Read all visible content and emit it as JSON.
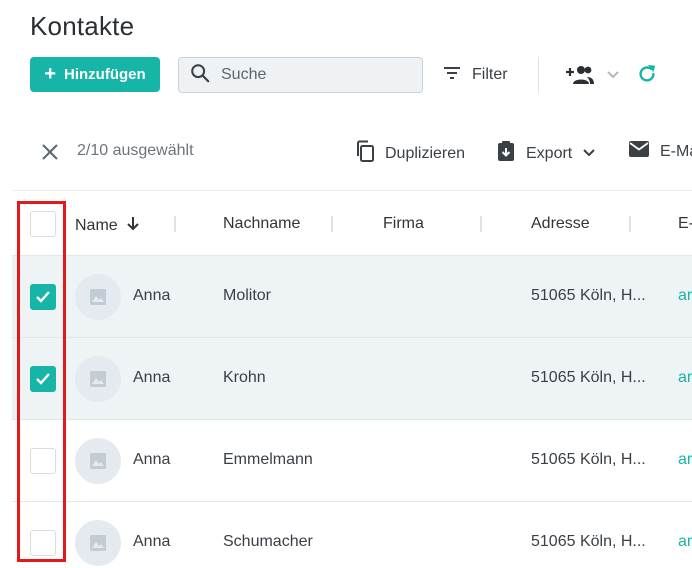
{
  "page": {
    "title": "Kontakte"
  },
  "toolbar": {
    "add_label": "Hinzufügen",
    "search_placeholder": "Suche",
    "filter_label": "Filter"
  },
  "selection_bar": {
    "count_text": "2/10 ausgewählt",
    "duplicate_label": "Duplizieren",
    "export_label": "Export",
    "email_label": "E-Ma"
  },
  "table": {
    "columns": {
      "name": "Name",
      "lastname": "Nachname",
      "company": "Firma",
      "address": "Adresse",
      "email": "E-"
    },
    "rows": [
      {
        "firstname": "Anna",
        "lastname": "Molitor",
        "company": "",
        "address": "51065 Köln, H...",
        "email": "ar",
        "selected": true
      },
      {
        "firstname": "Anna",
        "lastname": "Krohn",
        "company": "",
        "address": "51065 Köln, H...",
        "email": "ar",
        "selected": true
      },
      {
        "firstname": "Anna",
        "lastname": "Emmelmann",
        "company": "",
        "address": "51065 Köln, H...",
        "email": "ar",
        "selected": false
      },
      {
        "firstname": "Anna",
        "lastname": "Schumacher",
        "company": "",
        "address": "51065 Köln, H...",
        "email": "ar",
        "selected": false
      }
    ]
  },
  "icons": {
    "add": "plus-icon",
    "search": "search-icon",
    "filter": "filter-icon",
    "contacts": "group-add-icon",
    "chevron": "chevron-down-icon",
    "refresh": "refresh-icon",
    "close": "close-icon",
    "duplicate": "copy-icon",
    "export": "export-icon",
    "email": "mail-icon",
    "sort": "arrow-down-icon",
    "avatar": "image-placeholder-icon",
    "check": "check-icon"
  },
  "colors": {
    "accent": "#16b5a8",
    "highlight": "#e1191b",
    "selected_row": "#eef3f6"
  }
}
